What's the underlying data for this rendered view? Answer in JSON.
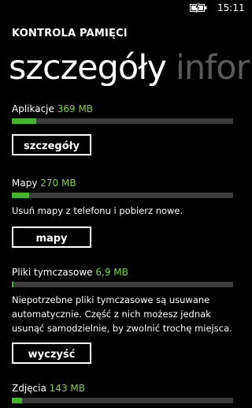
{
  "status_bar": {
    "time": "15:11",
    "battery_icon": "battery-charging-icon"
  },
  "app_title": "KONTROLA PAMIĘCI",
  "pivot": {
    "active": "szczegóły",
    "next": "infor"
  },
  "sections": {
    "apps": {
      "label": "Aplikacje",
      "size": "369 MB",
      "fill": 0.11,
      "button": "szczegóły"
    },
    "maps": {
      "label": "Mapy",
      "size": "270 MB",
      "fill": 0.08,
      "description": "Usuń mapy z telefonu i pobierz nowe.",
      "button": "mapy"
    },
    "temp": {
      "label": "Pliki tymczasowe",
      "size": "6,9 MB",
      "fill": 0.005,
      "description": "Niepotrzebne pliki tymczasowe są usuwane automatycznie. Część z nich możesz jednak usunąć samodzielnie, by zwolnić trochę miejsca.",
      "button": "wyczyść"
    },
    "photos": {
      "label": "Zdjęcia",
      "size": "143 MB",
      "fill": 0.045
    }
  },
  "colors": {
    "accent": "#45b52e",
    "size_text": "#7fd34a",
    "bar_track": "#3d3d3d",
    "pivot_inactive": "#5a5a5a"
  }
}
